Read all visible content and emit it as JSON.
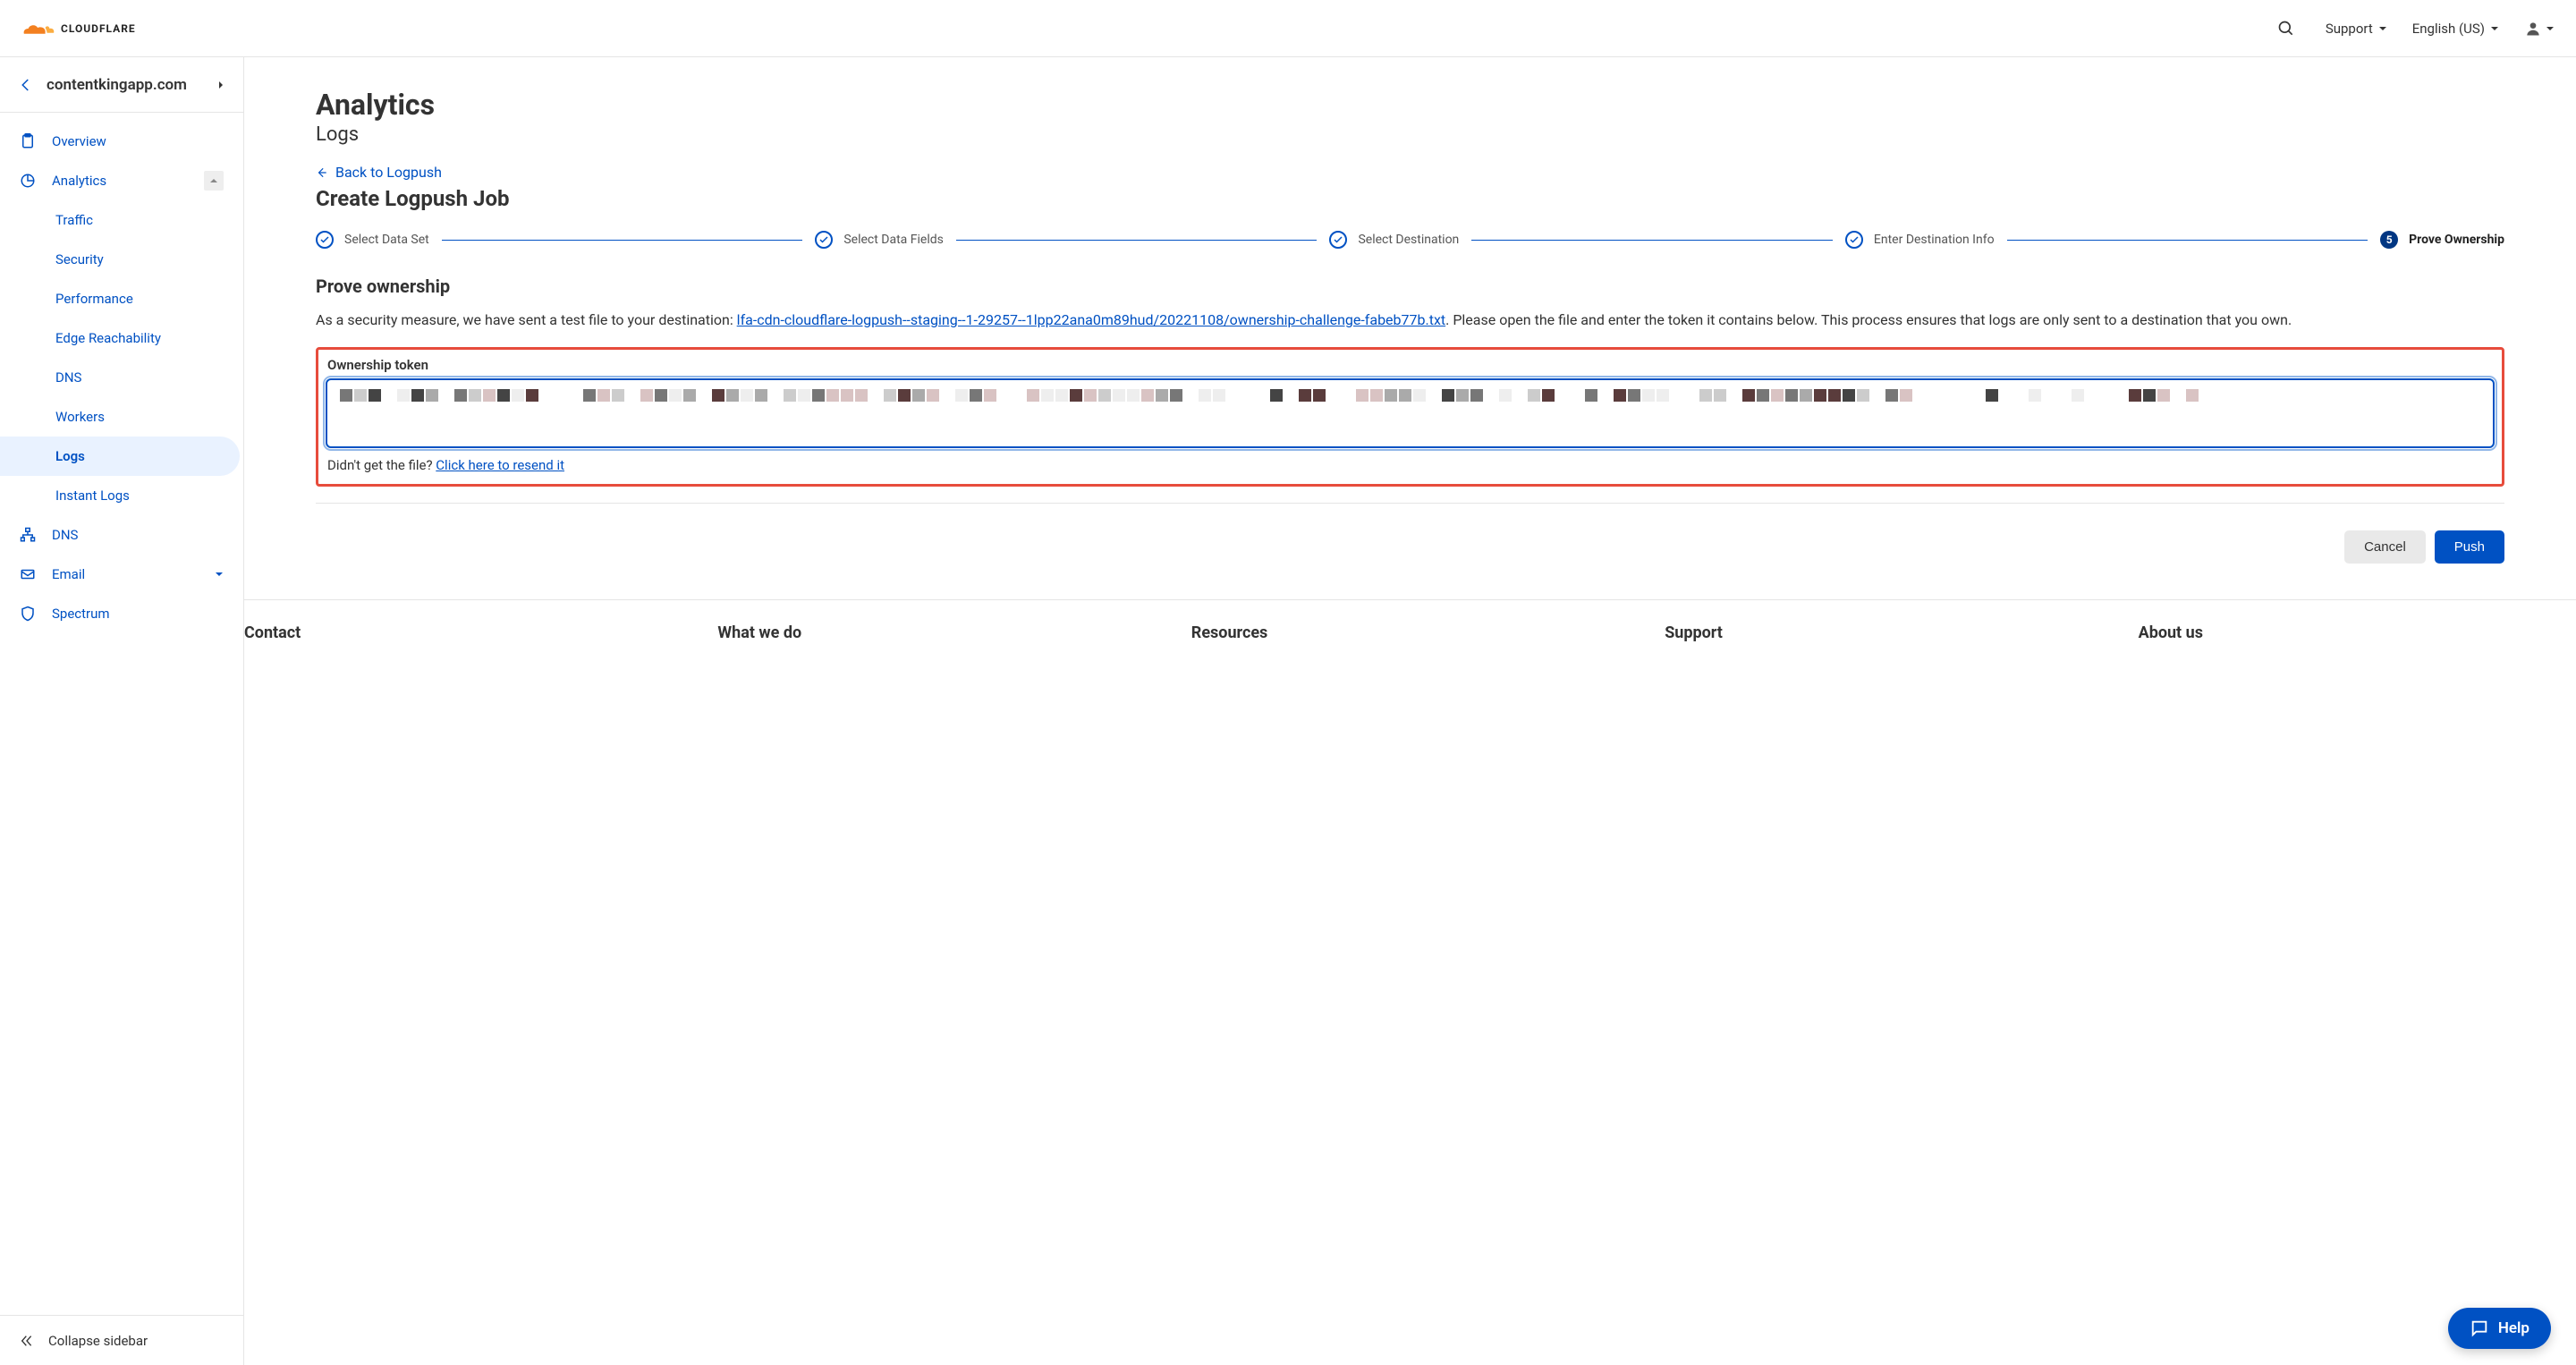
{
  "brand": {
    "name": "CLOUDFLARE"
  },
  "header": {
    "support": "Support",
    "language": "English (US)"
  },
  "sidebar": {
    "domain": "contentkingapp.com",
    "items": {
      "overview": "Overview",
      "analytics": "Analytics",
      "dns": "DNS",
      "email": "Email",
      "spectrum": "Spectrum"
    },
    "analytics_children": {
      "traffic": "Traffic",
      "security": "Security",
      "performance": "Performance",
      "edge_reachability": "Edge Reachability",
      "dns": "DNS",
      "workers": "Workers",
      "logs": "Logs",
      "instant_logs": "Instant Logs"
    },
    "collapse": "Collapse sidebar"
  },
  "page": {
    "title": "Analytics",
    "subtitle": "Logs",
    "back_label": "Back to Logpush",
    "section_title": "Create Logpush Job"
  },
  "steps": {
    "s1": "Select Data Set",
    "s2": "Select Data Fields",
    "s3": "Select Destination",
    "s4": "Enter Destination Info",
    "s5": "Prove Ownership",
    "active_num": "5"
  },
  "prove": {
    "heading": "Prove ownership",
    "intro_pre": "As a security measure, we have sent a test file to your destination: ",
    "file_link": "lfa-cdn-cloudflare-logpush--staging--1-29257--1lpp22ana0m89hud/20221108/ownership-challenge-fabeb77b.txt",
    "intro_post": ". Please open the file and enter the token it contains below. This process ensures that logs are only sent to a destination that you own.",
    "field_label": "Ownership token",
    "resend_pre": "Didn't get the file? ",
    "resend_link": "Click here to resend it"
  },
  "actions": {
    "cancel": "Cancel",
    "push": "Push"
  },
  "footer": {
    "col1": "Contact",
    "col2": "What we do",
    "col3": "Resources",
    "col4": "Support",
    "col5": "About us"
  },
  "help": {
    "label": "Help"
  }
}
